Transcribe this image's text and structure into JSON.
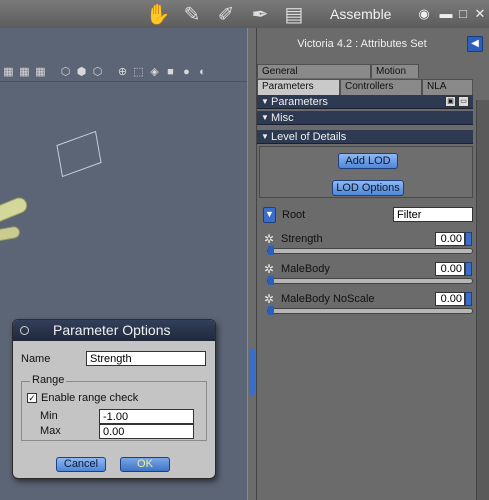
{
  "app": {
    "room_title": "Assemble",
    "room_tabs": [
      "pose-room",
      "face-room",
      "material-room",
      "hair-room",
      "movie-room"
    ]
  },
  "viewport": {
    "toolbar_icons": [
      "grid-icon",
      "grid-icon",
      "grid-icon",
      "shading-icon",
      "shading-icon",
      "shading-icon",
      "move-icon",
      "select-icon",
      "cube-icon",
      "sphere-icon",
      "sphere-icon"
    ]
  },
  "panel": {
    "title": "Victoria 4.2 : Attributes Set",
    "tabs_row1": [
      "General",
      "Motion"
    ],
    "tabs_row2": [
      "Parameters",
      "Controllers",
      "NLA"
    ],
    "sections": {
      "parameters": "Parameters",
      "misc": "Misc",
      "lod": "Level of Details"
    },
    "lod_buttons": {
      "add": "Add LOD",
      "options": "LOD Options"
    },
    "root_label": "Root",
    "filter_value": "Filter",
    "params": [
      {
        "name": "Strength",
        "value": "0.00"
      },
      {
        "name": "MaleBody",
        "value": "0.00"
      },
      {
        "name": "MaleBody NoScale",
        "value": "0.00"
      }
    ]
  },
  "dialog": {
    "title": "Parameter Options",
    "name_label": "Name",
    "name_value": "Strength",
    "range_legend": "Range",
    "enable_check_label": "Enable range check",
    "enable_checked": true,
    "min_label": "Min",
    "min_value": "-1.00",
    "max_label": "Max",
    "max_value": "0.00",
    "cancel_label": "Cancel",
    "ok_label": "OK"
  },
  "colors": {
    "accent_blue": "#3a6ec8",
    "header_navy": "#2d3a52",
    "viewport_bg": "#5c6575"
  }
}
